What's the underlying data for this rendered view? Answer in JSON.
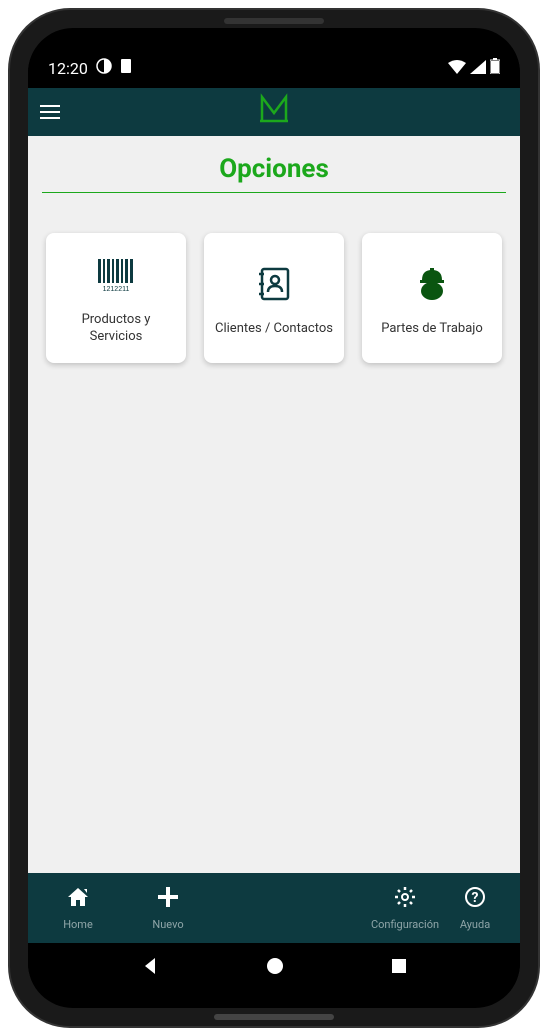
{
  "statusBar": {
    "time": "12:20"
  },
  "page": {
    "title": "Opciones"
  },
  "cards": [
    {
      "label": "Productos y Servicios"
    },
    {
      "label": "Clientes / Contactos"
    },
    {
      "label": "Partes de Trabajo"
    }
  ],
  "bottomNav": [
    {
      "label": "Home"
    },
    {
      "label": "Nuevo"
    },
    {
      "label": "Configuración"
    },
    {
      "label": "Ayuda"
    }
  ]
}
